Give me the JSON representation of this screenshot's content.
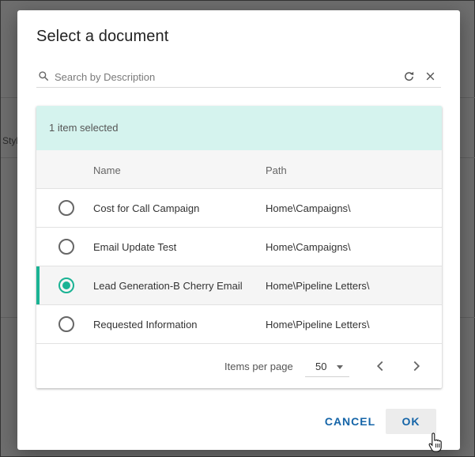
{
  "background": {
    "partial_text": "Styl"
  },
  "dialog": {
    "title": "Select a document",
    "search": {
      "placeholder": "Search by Description",
      "value": ""
    },
    "selection_status": "1 item selected",
    "table": {
      "columns": [
        "Name",
        "Path"
      ],
      "rows": [
        {
          "name": "Cost for Call Campaign",
          "path": "Home\\Campaigns\\",
          "selected": false
        },
        {
          "name": "Email Update Test",
          "path": "Home\\Campaigns\\",
          "selected": false
        },
        {
          "name": "Lead Generation-B Cherry Email",
          "path": "Home\\Pipeline Letters\\",
          "selected": true
        },
        {
          "name": "Requested Information",
          "path": "Home\\Pipeline Letters\\",
          "selected": false
        }
      ]
    },
    "paginator": {
      "items_per_page_label": "Items per page",
      "items_per_page_value": "50"
    },
    "actions": {
      "cancel_label": "CANCEL",
      "ok_label": "OK"
    }
  },
  "colors": {
    "accent": "#1ab394",
    "selection_bar": "#d5f3ee",
    "button_text": "#1565a8"
  },
  "icons": {
    "search": "search-icon",
    "refresh": "refresh-icon",
    "clear": "close-icon",
    "prev_page": "chevron-left-icon",
    "next_page": "chevron-right-icon",
    "items_per_page_dropdown": "caret-down-icon"
  }
}
